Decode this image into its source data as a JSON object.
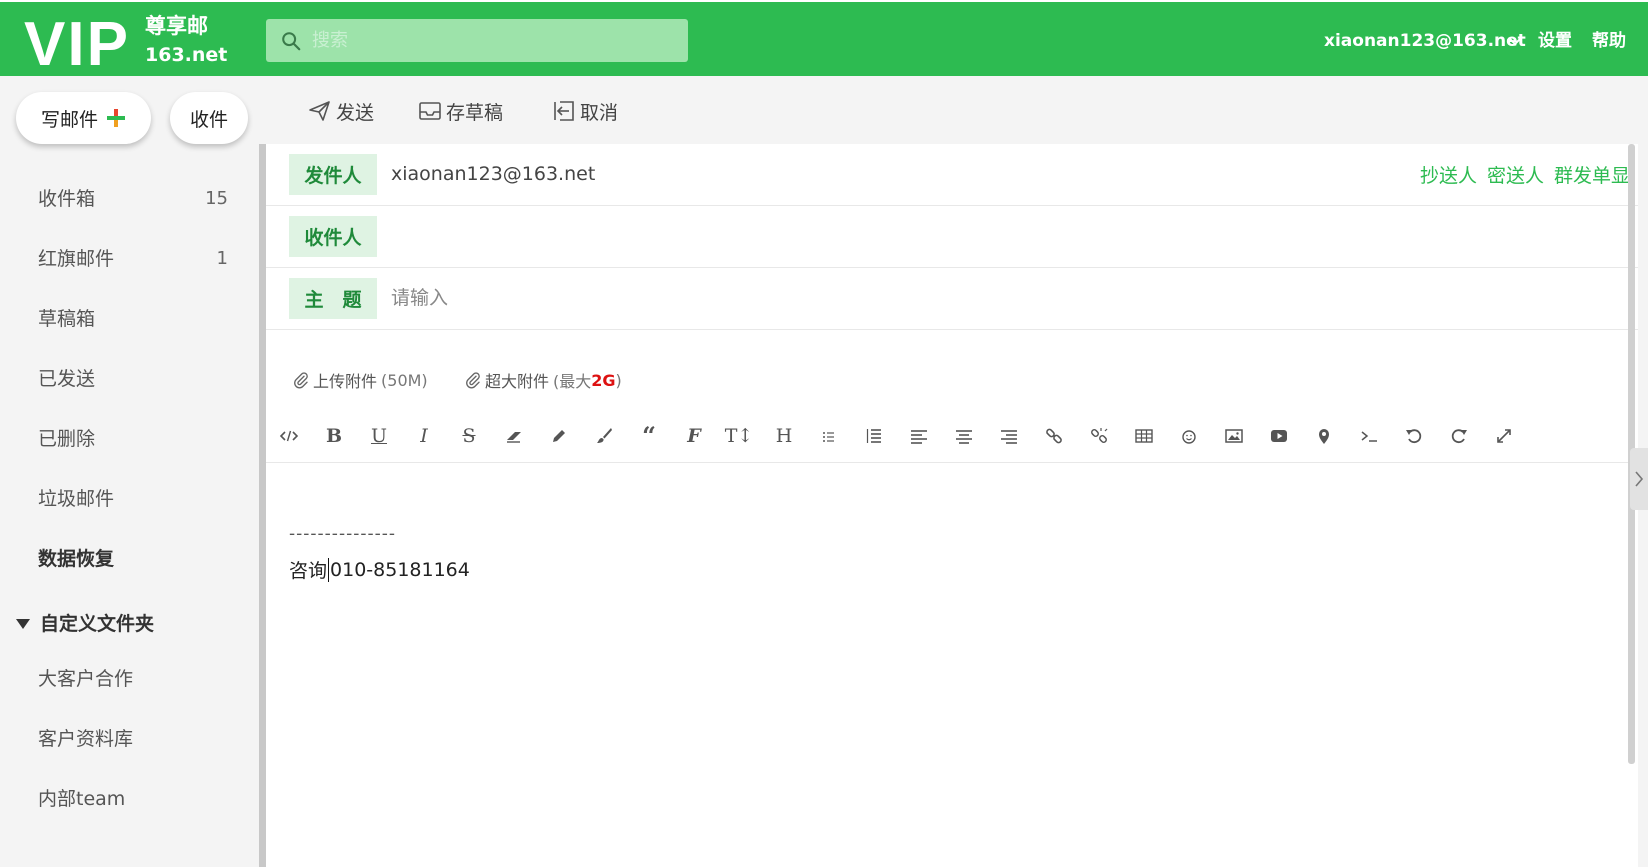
{
  "header": {
    "logo_main": "VIP",
    "logo_sub1": "尊享邮",
    "logo_sub2": "163.net",
    "search_placeholder": "搜索",
    "user_email": "xiaonan123@163.net",
    "settings": "设置",
    "help": "帮助",
    "brand_color": "#2dbb51"
  },
  "sidebar": {
    "compose": "写邮件",
    "receive": "收件",
    "folders": [
      {
        "label": "收件箱",
        "count": "15"
      },
      {
        "label": "红旗邮件",
        "count": "1"
      },
      {
        "label": "草稿箱",
        "count": ""
      },
      {
        "label": "已发送",
        "count": ""
      },
      {
        "label": "已删除",
        "count": ""
      },
      {
        "label": "垃圾邮件",
        "count": ""
      },
      {
        "label": "数据恢复",
        "count": ""
      }
    ],
    "custom_folders_label": "自定义文件夹",
    "custom_folders": [
      "大客户合作",
      "客户资料库",
      "内部team"
    ]
  },
  "toolbar": {
    "send": "发送",
    "save_draft": "存草稿",
    "cancel": "取消"
  },
  "compose": {
    "from_label": "发件人",
    "from_value": "xiaonan123@163.net",
    "cc": "抄送人",
    "bcc": "密送人",
    "separate": "群发单显",
    "to_label": "收件人",
    "subject_label": "主　题",
    "subject_placeholder": "请输入",
    "attach_label": "上传附件",
    "attach_limit": "(50M)",
    "large_attach_label": "超大附件",
    "large_attach_prefix": "(最大",
    "large_attach_size": "2G",
    "large_attach_suffix": ")",
    "format_icons": [
      "code-icon",
      "bold-icon",
      "underline-icon",
      "italic-icon",
      "strikethrough-icon",
      "eraser-icon",
      "pencil-icon",
      "brush-icon",
      "quote-icon",
      "font-icon",
      "text-size-icon",
      "heading-icon",
      "bullet-list-icon",
      "numbered-list-icon",
      "align-left-icon",
      "align-center-icon",
      "align-right-icon",
      "link-icon",
      "unlink-icon",
      "table-icon",
      "emoji-icon",
      "image-icon",
      "video-icon",
      "location-icon",
      "terminal-icon",
      "undo-icon",
      "redo-icon",
      "fullscreen-icon"
    ],
    "signature_dashes": "---------------",
    "signature_prefix": "咨询",
    "signature_phone": "010-85181164"
  }
}
